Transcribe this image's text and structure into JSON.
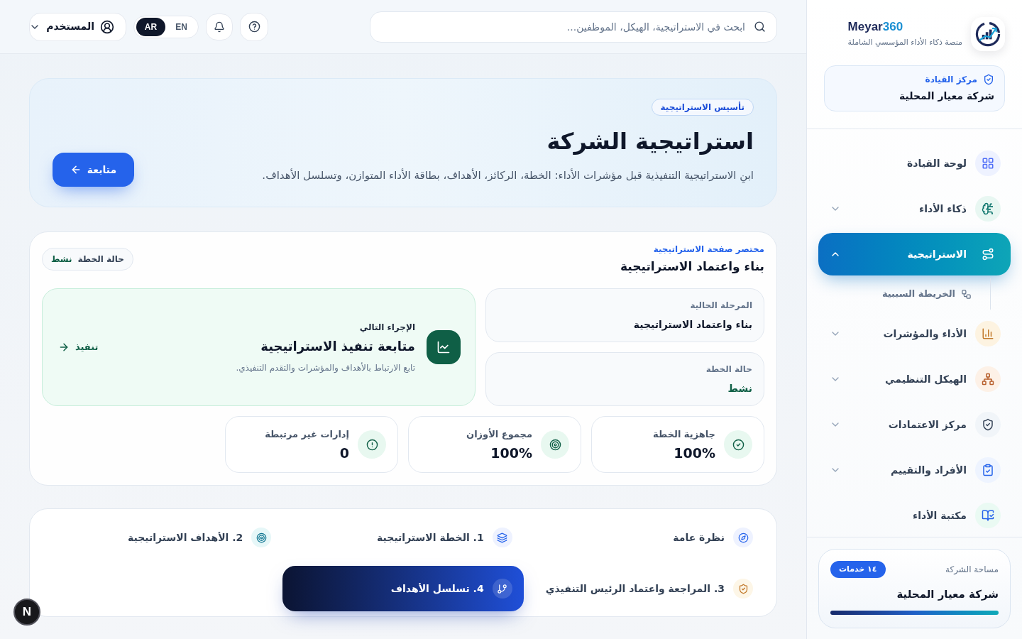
{
  "sidebar": {
    "brand": {
      "name": "Meyar",
      "accent": "360"
    },
    "tagline": "منصة ذكاء الأداء المؤسسي الشاملة",
    "context": {
      "label": "مركز القيادة",
      "value": "شركة معيار المحلية"
    },
    "nav": [
      {
        "label": "لوحة القيادة",
        "selected": false
      },
      {
        "label": "ذكاء الأداء",
        "selected": false,
        "expanded": false
      },
      {
        "label": "الاستراتيجية",
        "selected": true,
        "expanded": true,
        "children": [
          {
            "label": "الخريطة السببية",
            "selected": false
          }
        ]
      },
      {
        "label": "الأداء والمؤشرات",
        "selected": false,
        "expanded": false
      },
      {
        "label": "الهيكل التنظيمي",
        "selected": false,
        "expanded": false
      },
      {
        "label": "مركز الاعتمادات",
        "selected": false,
        "expanded": false
      },
      {
        "label": "الأفراد والتقييم",
        "selected": false,
        "expanded": false
      },
      {
        "label": "مكتبة الأداء",
        "selected": false
      }
    ],
    "workspace": {
      "label": "مساحة الشركة",
      "badge": "١٤ خدمات",
      "name": "شركة معيار المحلية"
    }
  },
  "topbar": {
    "search": {
      "placeholder": "ابحث في الاستراتيجية، الهيكل، الموظفين..."
    },
    "languages": [
      {
        "label": "EN",
        "selected": false
      },
      {
        "label": "AR",
        "selected": true
      }
    ],
    "user": {
      "label": "المستخدم"
    }
  },
  "hero": {
    "badge": "تأسيس الاستراتيجية",
    "title": "استراتيجية الشركة",
    "description": "ابنِ الاستراتيجية التنفيذية قبل مؤشرات الأداء: الخطة، الركائز، الأهداف، بطاقة الأداء المتوازن، وتسلسل الأهداف.",
    "button": "متابعة"
  },
  "summary": {
    "eyebrow": "مختصر صفحة الاستراتيجية",
    "title": "بناء واعتماد الاستراتيجية",
    "status_pill": {
      "label": "حالة الخطة",
      "value": "نشط"
    },
    "info_cards": [
      {
        "kind": "text",
        "label": "المرحلة الحالية",
        "value": "بناء واعتماد الاستراتيجية"
      },
      {
        "kind": "status",
        "label": "حالة الخطة",
        "value": "نشط"
      }
    ],
    "next_action": {
      "eyebrow": "الإجراء التالي",
      "title": "متابعة تنفيذ الاستراتيجية",
      "description": "تابع الارتباط بالأهداف والمؤشرات والتقدم التنفيذي.",
      "link": "تنفيذ"
    },
    "stats": [
      {
        "label": "جاهزية الخطة",
        "value": "100%"
      },
      {
        "label": "مجموع الأوزان",
        "value": "100%"
      },
      {
        "label": "إدارات غير مرتبطة",
        "value": "0"
      }
    ]
  },
  "steps": [
    {
      "label": "نظرة عامة",
      "selected": false
    },
    {
      "label": "1. الخطة الاستراتيجية",
      "selected": false
    },
    {
      "label": "2. الأهداف الاستراتيجية",
      "selected": false
    },
    {
      "label": "3. المراجعة واعتماد الرئيس التنفيذي",
      "selected": false
    },
    {
      "label": "4. تسلسل الأهداف",
      "selected": true
    }
  ],
  "dev_indicator": {
    "label": "N"
  }
}
